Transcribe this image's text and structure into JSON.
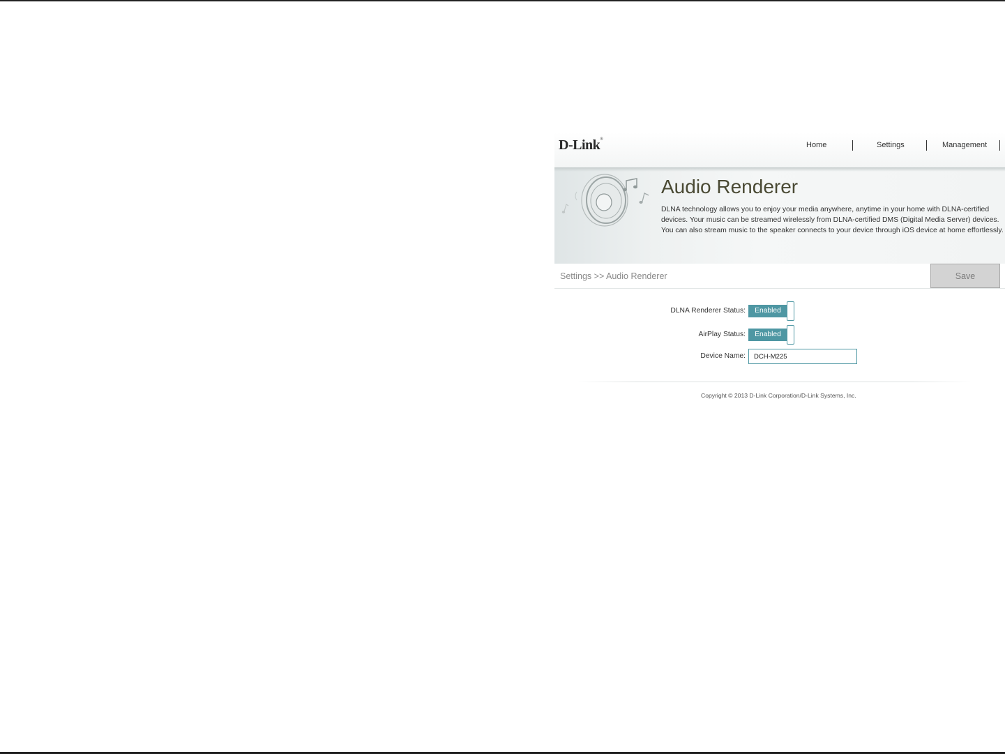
{
  "header": {
    "logo_text": "D-Link",
    "nav": [
      {
        "label": "Home"
      },
      {
        "label": "Settings"
      },
      {
        "label": "Management"
      }
    ]
  },
  "hero": {
    "title": "Audio Renderer",
    "description_lines": [
      "DLNA technology allows you to enjoy your media anywhere, anytime in your home with DLNA-certified",
      "devices. Your music can be streamed wirelessly from DLNA-certified DMS (Digital Media Server) devices.",
      "You can also stream music to the speaker connects to your device through iOS device at home effortlessly."
    ]
  },
  "breadcrumb": "Settings >> Audio Renderer",
  "save_label": "Save",
  "form": {
    "dlna_status": {
      "label": "DLNA Renderer Status:",
      "value": "Enabled"
    },
    "airplay_status": {
      "label": "AirPlay Status:",
      "value": "Enabled"
    },
    "device_name": {
      "label": "Device Name:",
      "value": "DCH-M225"
    }
  },
  "footer": {
    "copyright": "Copyright © 2013 D-Link Corporation/D-Link Systems, Inc."
  },
  "colors": {
    "accent": "#4e97a3",
    "save_bg": "#d3d3d3"
  }
}
